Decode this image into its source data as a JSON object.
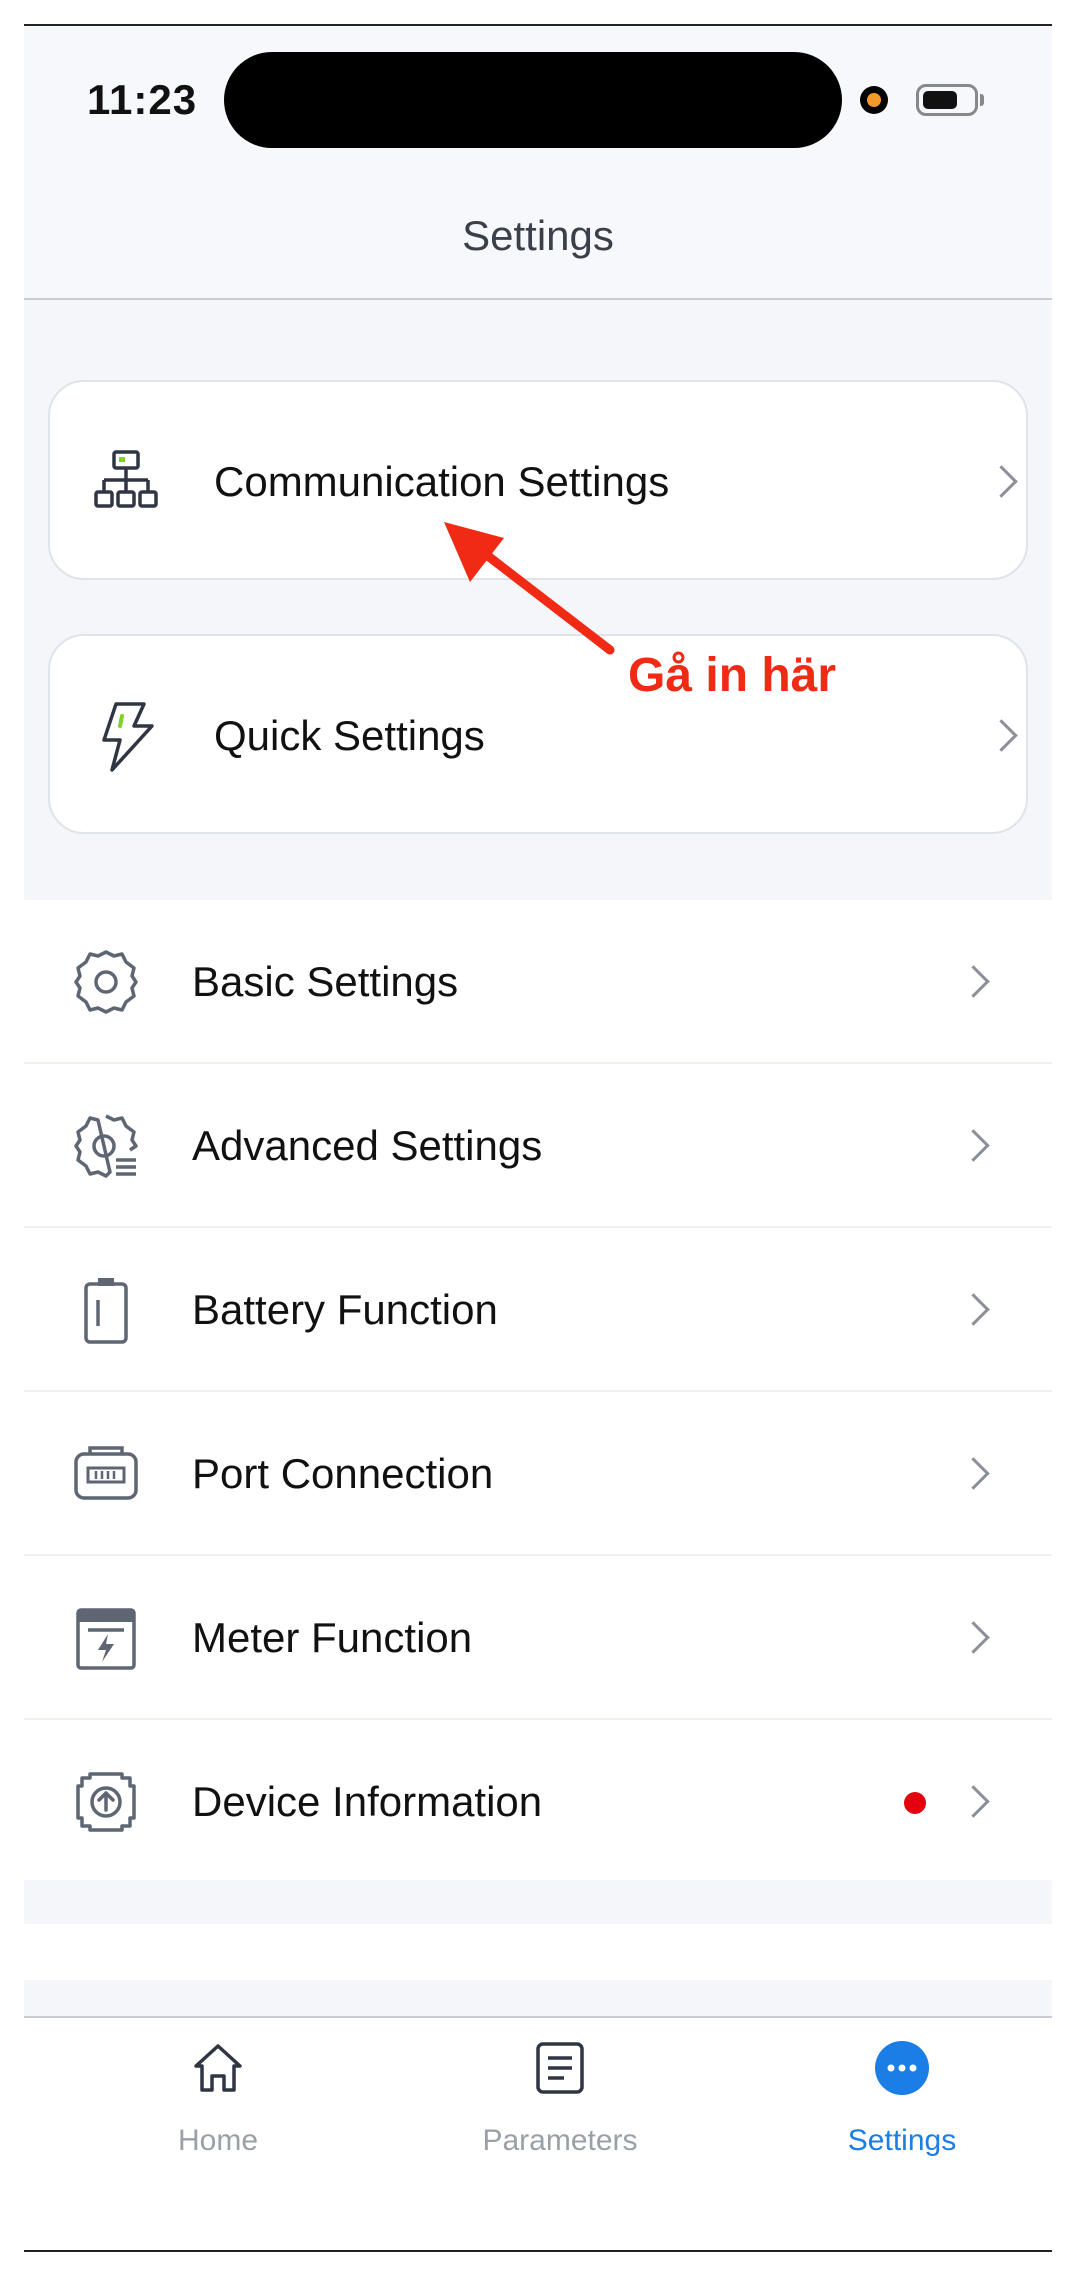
{
  "status_bar": {
    "time": "11:23"
  },
  "header": {
    "title": "Settings"
  },
  "cards": [
    {
      "label": "Communication Settings",
      "icon": "network-icon"
    },
    {
      "label": "Quick Settings",
      "icon": "lightning-icon"
    }
  ],
  "list": [
    {
      "label": "Basic Settings",
      "icon": "gear-icon"
    },
    {
      "label": "Advanced Settings",
      "icon": "advanced-gear-icon"
    },
    {
      "label": "Battery Function",
      "icon": "battery-icon"
    },
    {
      "label": "Port Connection",
      "icon": "port-icon"
    },
    {
      "label": "Meter Function",
      "icon": "meter-icon"
    },
    {
      "label": "Device Information",
      "icon": "device-upgrade-icon",
      "notification_dot": true
    }
  ],
  "tabbar": {
    "tabs": [
      {
        "label": "Home",
        "icon": "home-icon",
        "active": false
      },
      {
        "label": "Parameters",
        "icon": "document-icon",
        "active": false
      },
      {
        "label": "Settings",
        "icon": "more-dots-icon",
        "active": true
      }
    ]
  },
  "annotation": {
    "text": "Gå in här",
    "color": "#f02a14"
  },
  "colors": {
    "accent": "#1a7ee6",
    "notification": "#e4000f",
    "icon_gray": "#5f6673"
  }
}
